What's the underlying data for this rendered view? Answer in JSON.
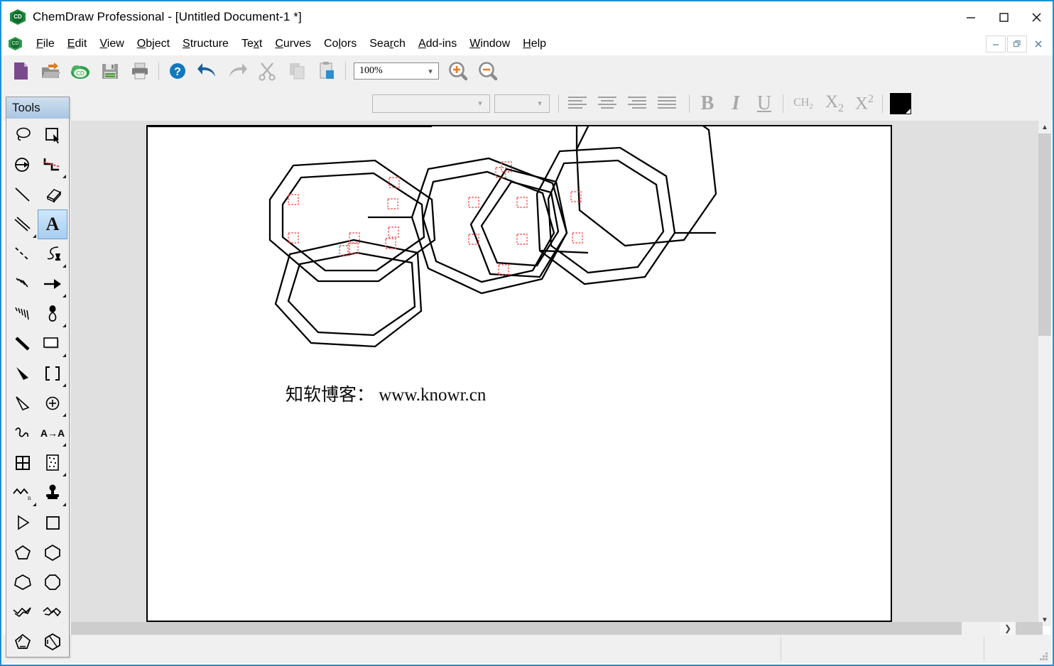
{
  "window": {
    "title": "ChemDraw Professional - [Untitled Document-1 *]",
    "app_icon": "chemdraw-logo-icon",
    "controls": [
      {
        "name": "minimize",
        "glyph": "—"
      },
      {
        "name": "maximize",
        "glyph": "□"
      },
      {
        "name": "close",
        "glyph": "✕"
      }
    ],
    "mdi_controls": [
      {
        "name": "restore-down",
        "glyph": "–"
      },
      {
        "name": "restore",
        "glyph": "❐"
      },
      {
        "name": "close-document",
        "glyph": "✕"
      }
    ]
  },
  "menu": {
    "items": [
      {
        "label": "File",
        "accel": "F"
      },
      {
        "label": "Edit",
        "accel": "E"
      },
      {
        "label": "View",
        "accel": "V"
      },
      {
        "label": "Object",
        "accel": "O"
      },
      {
        "label": "Structure",
        "accel": "S"
      },
      {
        "label": "Text",
        "accel": "x"
      },
      {
        "label": "Curves",
        "accel": "C"
      },
      {
        "label": "Colors",
        "accel": "l"
      },
      {
        "label": "Search",
        "accel": "r"
      },
      {
        "label": "Add-ins",
        "accel": "A"
      },
      {
        "label": "Window",
        "accel": "W"
      },
      {
        "label": "Help",
        "accel": "H"
      }
    ]
  },
  "toolbar_main": {
    "buttons": [
      {
        "name": "new-document-button",
        "icon": "new-document-icon",
        "enabled": true
      },
      {
        "name": "open-button",
        "icon": "open-folder-icon",
        "enabled": true
      },
      {
        "name": "chemdraw-cloud-button",
        "icon": "cloud-icon",
        "enabled": true
      },
      {
        "name": "save-button",
        "icon": "save-floppy-icon",
        "enabled": true
      },
      {
        "name": "print-button",
        "icon": "printer-icon",
        "enabled": true
      },
      {
        "name": "help-button",
        "icon": "question-mark-icon",
        "enabled": true
      },
      {
        "name": "undo-button",
        "icon": "undo-arrow-icon",
        "enabled": true
      },
      {
        "name": "redo-button",
        "icon": "redo-arrow-icon",
        "enabled": false
      },
      {
        "name": "cut-button",
        "icon": "scissors-icon",
        "enabled": false
      },
      {
        "name": "copy-button",
        "icon": "copy-pages-icon",
        "enabled": false
      },
      {
        "name": "paste-button",
        "icon": "clipboard-icon",
        "enabled": true
      }
    ],
    "zoom": {
      "value": "100%",
      "zoom_in_icon": "magnifier-plus-icon",
      "zoom_out_icon": "magnifier-minus-icon"
    }
  },
  "toolbar_text": {
    "font_name": {
      "value": "",
      "placeholder": ""
    },
    "font_size": {
      "value": "",
      "placeholder": ""
    },
    "align_buttons": [
      {
        "name": "align-left-button",
        "icon": "align-left-icon"
      },
      {
        "name": "align-center-button",
        "icon": "align-center-icon"
      },
      {
        "name": "align-right-button",
        "icon": "align-right-icon"
      },
      {
        "name": "align-justify-button",
        "icon": "align-justify-icon"
      }
    ],
    "style_buttons": [
      {
        "name": "bold-button",
        "label": "B",
        "icon": "bold-icon"
      },
      {
        "name": "italic-button",
        "label": "I",
        "icon": "italic-icon"
      },
      {
        "name": "underline-button",
        "label": "U",
        "icon": "underline-icon"
      },
      {
        "name": "formula-button",
        "label": "CH2",
        "icon": "formula-icon"
      },
      {
        "name": "subscript-button",
        "label": "X2",
        "icon": "subscript-icon"
      },
      {
        "name": "superscript-button",
        "label": "X2",
        "icon": "superscript-icon"
      }
    ],
    "color_swatch": {
      "name": "text-color-swatch",
      "color": "#000000"
    }
  },
  "tools_palette": {
    "title": "Tools",
    "selected_tool": "text-tool",
    "items": [
      {
        "name": "lasso-select-tool",
        "icon": "lasso-icon",
        "submenu": false
      },
      {
        "name": "marquee-select-tool",
        "icon": "marquee-icon",
        "submenu": false
      },
      {
        "name": "structure-perspective-tool",
        "icon": "circle-arrow-icon",
        "submenu": false
      },
      {
        "name": "bond-chain-tool",
        "icon": "dashed-chain-icon",
        "submenu": true
      },
      {
        "name": "solid-bond-tool",
        "icon": "solid-bond-icon",
        "submenu": false
      },
      {
        "name": "eraser-tool",
        "icon": "eraser-icon",
        "submenu": false
      },
      {
        "name": "multiple-bond-tool",
        "icon": "double-bond-icon",
        "submenu": true
      },
      {
        "name": "text-tool",
        "icon": "letter-a-icon",
        "submenu": false
      },
      {
        "name": "dashed-bond-tool",
        "icon": "dashed-bond-icon",
        "submenu": false
      },
      {
        "name": "pen-tool",
        "icon": "pen-nib-icon",
        "submenu": true
      },
      {
        "name": "hashed-wedge-tool",
        "icon": "hashed-wedge-icon",
        "submenu": false
      },
      {
        "name": "arrow-tool",
        "icon": "arrow-icon",
        "submenu": true
      },
      {
        "name": "hashed-bond-tool",
        "icon": "hash-spray-icon",
        "submenu": false
      },
      {
        "name": "orbital-tool",
        "icon": "orbital-icon",
        "submenu": true
      },
      {
        "name": "bold-bond-tool",
        "icon": "bold-bond-icon",
        "submenu": false
      },
      {
        "name": "frame-tool",
        "icon": "rectangle-frame-icon",
        "submenu": true
      },
      {
        "name": "wedge-bond-tool",
        "icon": "wedge-bond-icon",
        "submenu": false
      },
      {
        "name": "bracket-tool",
        "icon": "brackets-icon",
        "submenu": true
      },
      {
        "name": "hollow-wedge-tool",
        "icon": "hollow-wedge-icon",
        "submenu": false
      },
      {
        "name": "charge-tool",
        "icon": "circle-plus-icon",
        "submenu": true
      },
      {
        "name": "squiggle-bond-tool",
        "icon": "squiggle-icon",
        "submenu": false
      },
      {
        "name": "atom-replace-tool",
        "icon": "a-to-a-icon",
        "submenu": true
      },
      {
        "name": "table-tool",
        "icon": "table-grid-icon",
        "submenu": false
      },
      {
        "name": "template-tool",
        "icon": "template-page-icon",
        "submenu": true
      },
      {
        "name": "polymer-bracket-tool",
        "icon": "polymer-chain-icon",
        "submenu": true
      },
      {
        "name": "stamp-tool",
        "icon": "stamp-icon",
        "submenu": true
      },
      {
        "name": "acyclic-chain-tool",
        "icon": "triangle-outline-icon",
        "submenu": false
      },
      {
        "name": "square-tool",
        "icon": "square-icon",
        "submenu": false
      },
      {
        "name": "cyclopentane-tool",
        "icon": "pentagon-icon",
        "submenu": false
      },
      {
        "name": "cyclohexane-tool",
        "icon": "hexagon-icon",
        "submenu": false
      },
      {
        "name": "cycloheptane-tool",
        "icon": "heptagon-icon",
        "submenu": false
      },
      {
        "name": "cyclooctane-tool",
        "icon": "octagon-icon",
        "submenu": false
      },
      {
        "name": "chair-left-tool",
        "icon": "chair-left-icon",
        "submenu": false
      },
      {
        "name": "chair-right-tool",
        "icon": "chair-right-icon",
        "submenu": false
      },
      {
        "name": "cyclopentadiene-tool",
        "icon": "cyclopentadiene-icon",
        "submenu": false
      },
      {
        "name": "benzene-tool",
        "icon": "benzene-ring-icon",
        "submenu": false
      }
    ]
  },
  "document": {
    "watermark_text": "知软博客： www.knowr.cn",
    "selection_marker_color": "#ff4d4d",
    "bond_color": "#000000",
    "page_background": "#ffffff",
    "workspace_background": "#e0e0e0"
  },
  "scrollbars": {
    "vertical": {
      "up_arrow_icon": "chevron-up-icon",
      "down_arrow_icon": "chevron-down-icon"
    },
    "horizontal": {
      "right_arrow_icon": "chevron-right-icon"
    }
  },
  "statusbar": {
    "cells": [
      "",
      "",
      ""
    ],
    "grip_icon": "resize-grip-icon"
  }
}
